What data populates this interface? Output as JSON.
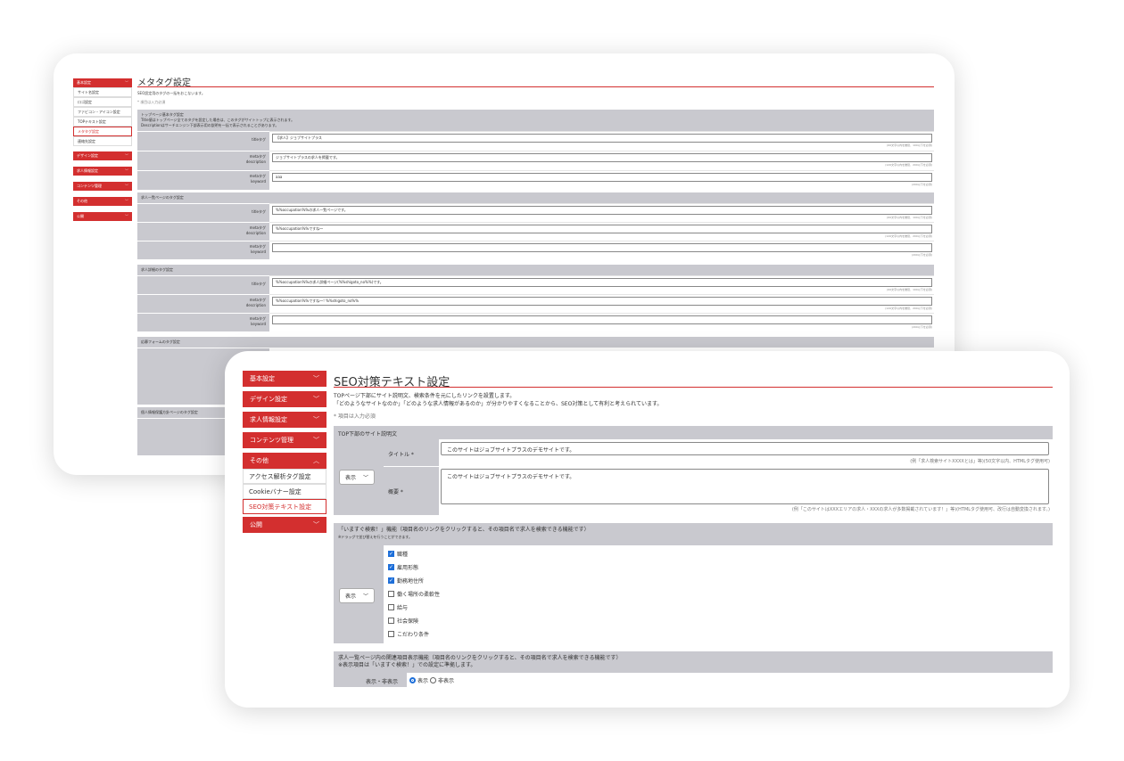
{
  "back_page": {
    "sidebar": {
      "items": [
        {
          "label": "基本設定",
          "chevron": "﹀"
        },
        {
          "label": "デザイン設定",
          "chevron": "﹀"
        },
        {
          "label": "求人情報設定",
          "chevron": "﹀"
        },
        {
          "label": "コンテンツ管理",
          "chevron": "﹀"
        },
        {
          "label": "その他",
          "chevron": "﹀"
        },
        {
          "label": "公開",
          "chevron": "﹀"
        }
      ],
      "subitems": [
        "サイト名設定",
        "ロゴ設定",
        "ファビコン・アイコン設定",
        "TOPテキスト設定",
        "メタタグ設定",
        "連絡先設定"
      ]
    },
    "title": "メタタグ設定",
    "intro": "SEO設定用のタグの一括をおこないます。",
    "required_note": "* 項目は入力必須",
    "sections": [
      {
        "heading": "トップページ基本タグ設定\nTitle値はトップページ全てのタグを設定した場合は、このタグがサイトトップに表示されます。\nDescriptionはサーチエンジン下部表示用の説明を一括で表示されることがあります。",
        "rows": [
          {
            "label": "titleタグ",
            "value": "【求人】ジョブサイトプラス",
            "hint": "(60文字以内を推奨、100以下を必須)"
          },
          {
            "label": "metaタグ\ndescription",
            "value": "ジョブサイトプラスの求人を掲載です。",
            "hint": "(120文字以内を推奨、200以下を必須)"
          },
          {
            "label": "metaタグ\nkeyword",
            "value": "aaa",
            "hint": "(200以下を必須)"
          }
        ]
      },
      {
        "heading": "求人一覧ページのタグ設定",
        "rows": [
          {
            "label": "titleタグ",
            "value": "%%occupation%%の求人一覧ページです。",
            "hint": "(60文字以内を推奨、100以下を必須)"
          },
          {
            "label": "metaタグ\ndescription",
            "value": "%%occupation%%ですね〜",
            "hint": "(120文字以内を推奨、200以下を必須)"
          },
          {
            "label": "metaタグ\nkeyword",
            "value": "",
            "hint": "(200以下を必須)"
          }
        ]
      },
      {
        "heading": "求人詳細のタグ設定",
        "rows": [
          {
            "label": "titleタグ",
            "value": "%%occupation%%の求人詳細ページ(%%shigoto_no%%)です。",
            "hint": "(60文字以内を推奨、100以下を必須)"
          },
          {
            "label": "metaタグ\ndescription",
            "value": "%%occupation%%ですね〜! %%shigoto_no%%",
            "hint": "(120文字以内を推奨、200以下を必須)"
          },
          {
            "label": "metaタグ\nkeyword",
            "value": "",
            "hint": "(200以下を必須)"
          }
        ]
      },
      {
        "heading": "応募フォームのタグ設定",
        "rows": []
      },
      {
        "heading": "個人情報保護方針ページのタグ設定",
        "rows": []
      }
    ]
  },
  "front_page": {
    "sidebar": {
      "items": [
        {
          "label": "基本設定",
          "chevron": "﹀"
        },
        {
          "label": "デザイン設定",
          "chevron": "﹀"
        },
        {
          "label": "求人情報設定",
          "chevron": "﹀"
        },
        {
          "label": "コンテンツ管理",
          "chevron": "﹀"
        },
        {
          "label": "その他",
          "chevron": "︿"
        },
        {
          "label": "公開",
          "chevron": "﹀"
        }
      ],
      "subitems": [
        "アクセス解析タグ設定",
        "Cookieバナー設定",
        "SEO対策テキスト設定"
      ]
    },
    "title": "SEO対策テキスト設定",
    "intro_1": "TOPページ下部にサイト説明文、検索条件を元にしたリンクを設置します。",
    "intro_2": "「どのようなサイトなのか」「どのような求人情報があるのか」が分かりやすくなることから、SEO対策として有利と考えられています。",
    "required_note": "* 項目は入力必須",
    "section1": {
      "heading": "TOP下部のサイト説明文",
      "select": "表示",
      "title_label": "タイトル *",
      "title_value": "このサイトはジョブサイトプラスのデモサイトです。",
      "title_hint": "(例「求人検索サイトXXXXとは」等)(50文字以内、HTMLタグ使用可)",
      "summary_label": "概要 *",
      "summary_value": "このサイトはジョブサイトプラスのデモサイトです。",
      "summary_hint": "(例「このサイトはXXXエリアの求人・XXXの求人が多数掲載されています！」等)(HTMLタグ使用可、改行は自動変換されます。)"
    },
    "section2": {
      "heading": "「いますぐ検索！」機能（項目名のリンクをクリックすると、その項目名で求人を検索できる機能です）",
      "subheading": "※ドラッグで並び替えを行うことができます。",
      "select": "表示",
      "options": [
        {
          "label": "職種",
          "checked": true
        },
        {
          "label": "雇用形態",
          "checked": true
        },
        {
          "label": "勤務地住所",
          "checked": true
        },
        {
          "label": "働く場所の柔軟性",
          "checked": false
        },
        {
          "label": "給与",
          "checked": false
        },
        {
          "label": "社会保険",
          "checked": false
        },
        {
          "label": "こだわり条件",
          "checked": false
        }
      ]
    },
    "section3": {
      "heading": "求人一覧ページ内の関連項目表示機能（項目名のリンクをクリックすると、その項目名で求人を検索できる機能です）",
      "subheading": "※表示項目は「いますぐ検索！」での設定に準拠します。",
      "toggle_label": "表示・非表示",
      "radio_show": "表示",
      "radio_hide": "非表示"
    }
  },
  "colors": {
    "accent": "#d32f2f",
    "checkbox": "#1e6fd9",
    "section_grey": "#c9c9cf"
  }
}
